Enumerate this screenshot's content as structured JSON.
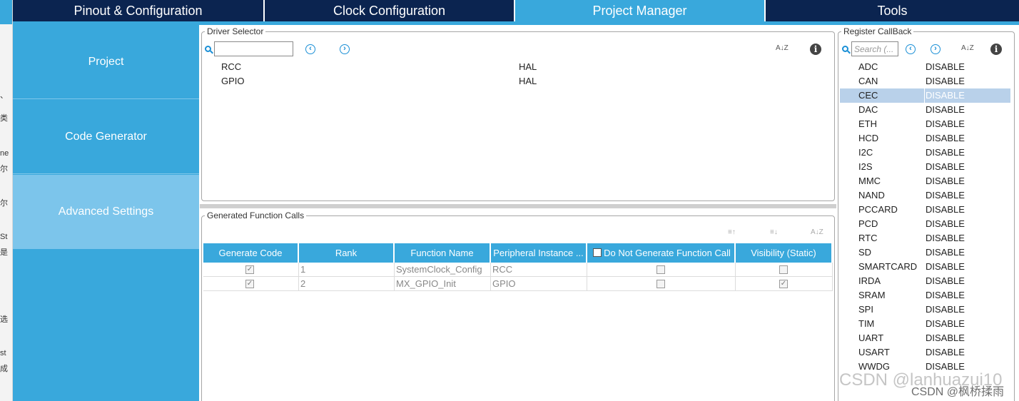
{
  "left_strip": {
    "chars": [
      "、",
      "类",
      "ne",
      "尔",
      "尔",
      "St",
      "是",
      "选",
      "st",
      "成"
    ]
  },
  "tabs": [
    {
      "label": "Pinout & Configuration",
      "active": false
    },
    {
      "label": "Clock Configuration",
      "active": false
    },
    {
      "label": "Project Manager",
      "active": true
    },
    {
      "label": "Tools",
      "active": false
    }
  ],
  "side_nav": [
    {
      "label": "Project",
      "active": false
    },
    {
      "label": "Code Generator",
      "active": false
    },
    {
      "label": "Advanced Settings",
      "active": true
    }
  ],
  "driver_selector": {
    "title": "Driver Selector",
    "search_value": "",
    "prev_icon": "‹",
    "next_icon": "›",
    "sort_icon": "A↓Z",
    "info_icon": "i",
    "rows": [
      {
        "name": "RCC",
        "driver": "HAL"
      },
      {
        "name": "GPIO",
        "driver": "HAL"
      }
    ]
  },
  "generated_calls": {
    "title": "Generated Function Calls",
    "columns": [
      "Generate Code",
      "Rank",
      "Function Name",
      "Peripheral Instance ...",
      "Do Not Generate Function Call",
      "Visibility (Static)"
    ],
    "rows": [
      {
        "generate": "✓",
        "rank": "1",
        "function": "SystemClock_Config",
        "instance": "RCC",
        "no_call": "",
        "visibility": ""
      },
      {
        "generate": "✓",
        "rank": "2",
        "function": "MX_GPIO_Init",
        "instance": "GPIO",
        "no_call": "",
        "visibility": "✓"
      }
    ]
  },
  "register_callback": {
    "title": "Register CallBack",
    "search_placeholder": "Search (...",
    "items": [
      {
        "name": "ADC",
        "value": "DISABLE"
      },
      {
        "name": "CAN",
        "value": "DISABLE"
      },
      {
        "name": "CEC",
        "value": "DISABLE",
        "selected": true
      },
      {
        "name": "DAC",
        "value": "DISABLE"
      },
      {
        "name": "ETH",
        "value": "DISABLE"
      },
      {
        "name": "HCD",
        "value": "DISABLE"
      },
      {
        "name": "I2C",
        "value": "DISABLE"
      },
      {
        "name": "I2S",
        "value": "DISABLE"
      },
      {
        "name": "MMC",
        "value": "DISABLE"
      },
      {
        "name": "NAND",
        "value": "DISABLE"
      },
      {
        "name": "PCCARD",
        "value": "DISABLE"
      },
      {
        "name": "PCD",
        "value": "DISABLE"
      },
      {
        "name": "RTC",
        "value": "DISABLE"
      },
      {
        "name": "SD",
        "value": "DISABLE"
      },
      {
        "name": "SMARTCARD",
        "value": "DISABLE"
      },
      {
        "name": "IRDA",
        "value": "DISABLE"
      },
      {
        "name": "SRAM",
        "value": "DISABLE"
      },
      {
        "name": "SPI",
        "value": "DISABLE"
      },
      {
        "name": "TIM",
        "value": "DISABLE"
      },
      {
        "name": "UART",
        "value": "DISABLE"
      },
      {
        "name": "USART",
        "value": "DISABLE"
      },
      {
        "name": "WWDG",
        "value": "DISABLE"
      }
    ]
  },
  "watermark": {
    "text": "CSDN @lanhuazui10",
    "text2": "CSDN @枫桥揉雨"
  },
  "colors": {
    "tab_dark": "#0b2450",
    "accent": "#39a8dc",
    "nav_active": "#7cc5eb",
    "selected_row": "#b9d1ea"
  }
}
